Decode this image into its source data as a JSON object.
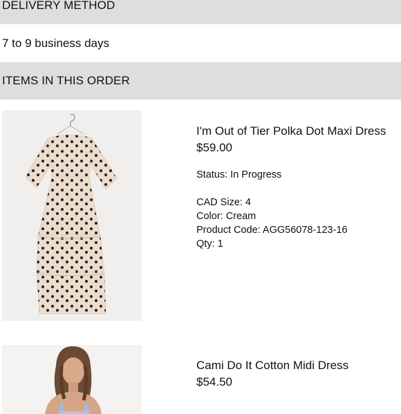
{
  "delivery": {
    "header": "DELIVERY METHOD",
    "value": "7 to 9 business days"
  },
  "items_section": {
    "header": "ITEMS IN THIS ORDER"
  },
  "items": [
    {
      "name": "I'm Out of Tier Polka Dot Maxi Dress",
      "price": "$59.00",
      "status": "Status: In Progress",
      "size": "CAD Size: 4",
      "color": "Color: Cream",
      "product_code": "Product Code: AGG56078-123-16",
      "qty": "Qty: 1",
      "image": "polka-dot-maxi-dress-photo"
    },
    {
      "name": "Cami Do It Cotton Midi Dress",
      "price": "$54.50",
      "image": "cami-cotton-midi-dress-photo"
    }
  ],
  "colors": {
    "section_header_bg": "#dedede",
    "thumb_bg": "#f1efee",
    "dress_cream": "#ecdccd",
    "dot": "#2b2520"
  }
}
